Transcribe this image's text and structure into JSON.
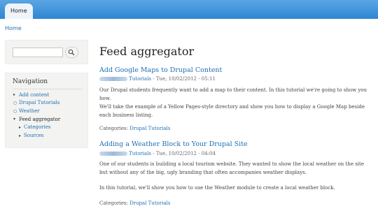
{
  "tabs": [
    {
      "label": "Home"
    }
  ],
  "breadcrumb": {
    "home": "Home"
  },
  "search": {
    "placeholder": "",
    "button_icon": "search-icon"
  },
  "navigation": {
    "title": "Navigation",
    "items": [
      {
        "label": "Add content"
      },
      {
        "label": "Drupal Tutorials"
      },
      {
        "label": "Weather"
      },
      {
        "label": "Feed aggregator"
      }
    ],
    "subitems": [
      {
        "label": "Categories"
      },
      {
        "label": "Sources"
      }
    ]
  },
  "page": {
    "title": "Feed aggregator",
    "articles": [
      {
        "title": "Add Google Maps to Drupal Content",
        "author": "Tutorials",
        "date": "- Tue, 10/02/2012 - 05:11",
        "paragraphs": [
          "Our Drupal students frequently want to add a map to their content. In this tutorial we're going to show you how.",
          "We'll take the example of a Yellow Pages-style directory and show you how to display a Google Map beside each business listing."
        ],
        "categories_label": "Categories:",
        "category": "Drupal Tutorials"
      },
      {
        "title": "Adding a Weather Block to Your Drupal Site",
        "author": "Tutorials",
        "date": "- Tue, 10/02/2012 - 04:04",
        "paragraphs": [
          "One of our students is building a local tourism website. They wanted to show the local weather on the site but without any of the big, ugly branding that often accompanies weather displays.",
          "In this tutorial, we'll show you how to use the Weather module to create a local weather block."
        ],
        "categories_label": "Categories:",
        "category": "Drupal Tutorials"
      }
    ]
  }
}
